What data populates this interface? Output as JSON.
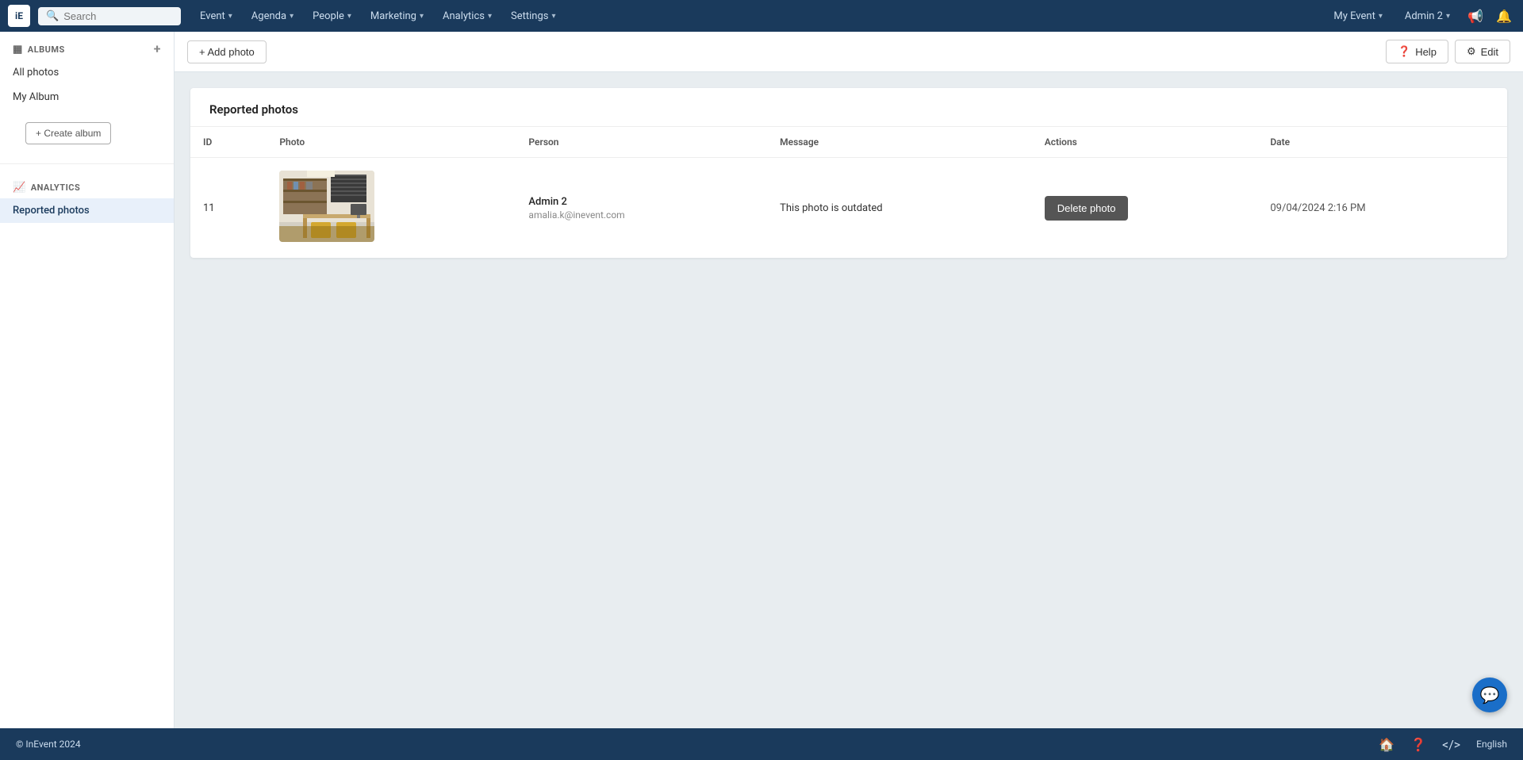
{
  "topnav": {
    "logo_label": "iE",
    "search_placeholder": "Search",
    "nav_items": [
      {
        "label": "Event",
        "has_chevron": true
      },
      {
        "label": "Agenda",
        "has_chevron": true
      },
      {
        "label": "People",
        "has_chevron": true
      },
      {
        "label": "Marketing",
        "has_chevron": true
      },
      {
        "label": "Analytics",
        "has_chevron": true
      },
      {
        "label": "Settings",
        "has_chevron": true
      }
    ],
    "my_event_label": "My Event",
    "admin_label": "Admin 2"
  },
  "sidebar": {
    "albums_section_label": "ALBUMS",
    "all_photos_label": "All photos",
    "my_album_label": "My Album",
    "create_album_label": "+ Create album",
    "analytics_section_label": "ANALYTICS",
    "reported_photos_label": "Reported photos"
  },
  "toolbar": {
    "add_photo_label": "+ Add photo",
    "help_label": "⚙ Help",
    "edit_label": "✎ Edit"
  },
  "table": {
    "title": "Reported photos",
    "columns": [
      "ID",
      "Photo",
      "Person",
      "Message",
      "Actions",
      "Date"
    ],
    "rows": [
      {
        "id": "11",
        "photo_alt": "Office room with desk and chairs",
        "person_name": "Admin 2",
        "person_email": "amalia.k@inevent.com",
        "message": "This photo is outdated",
        "action_label": "Delete photo",
        "date": "09/04/2024 2:16 PM"
      }
    ]
  },
  "bottombar": {
    "copyright": "© InEvent 2024",
    "language": "English"
  }
}
